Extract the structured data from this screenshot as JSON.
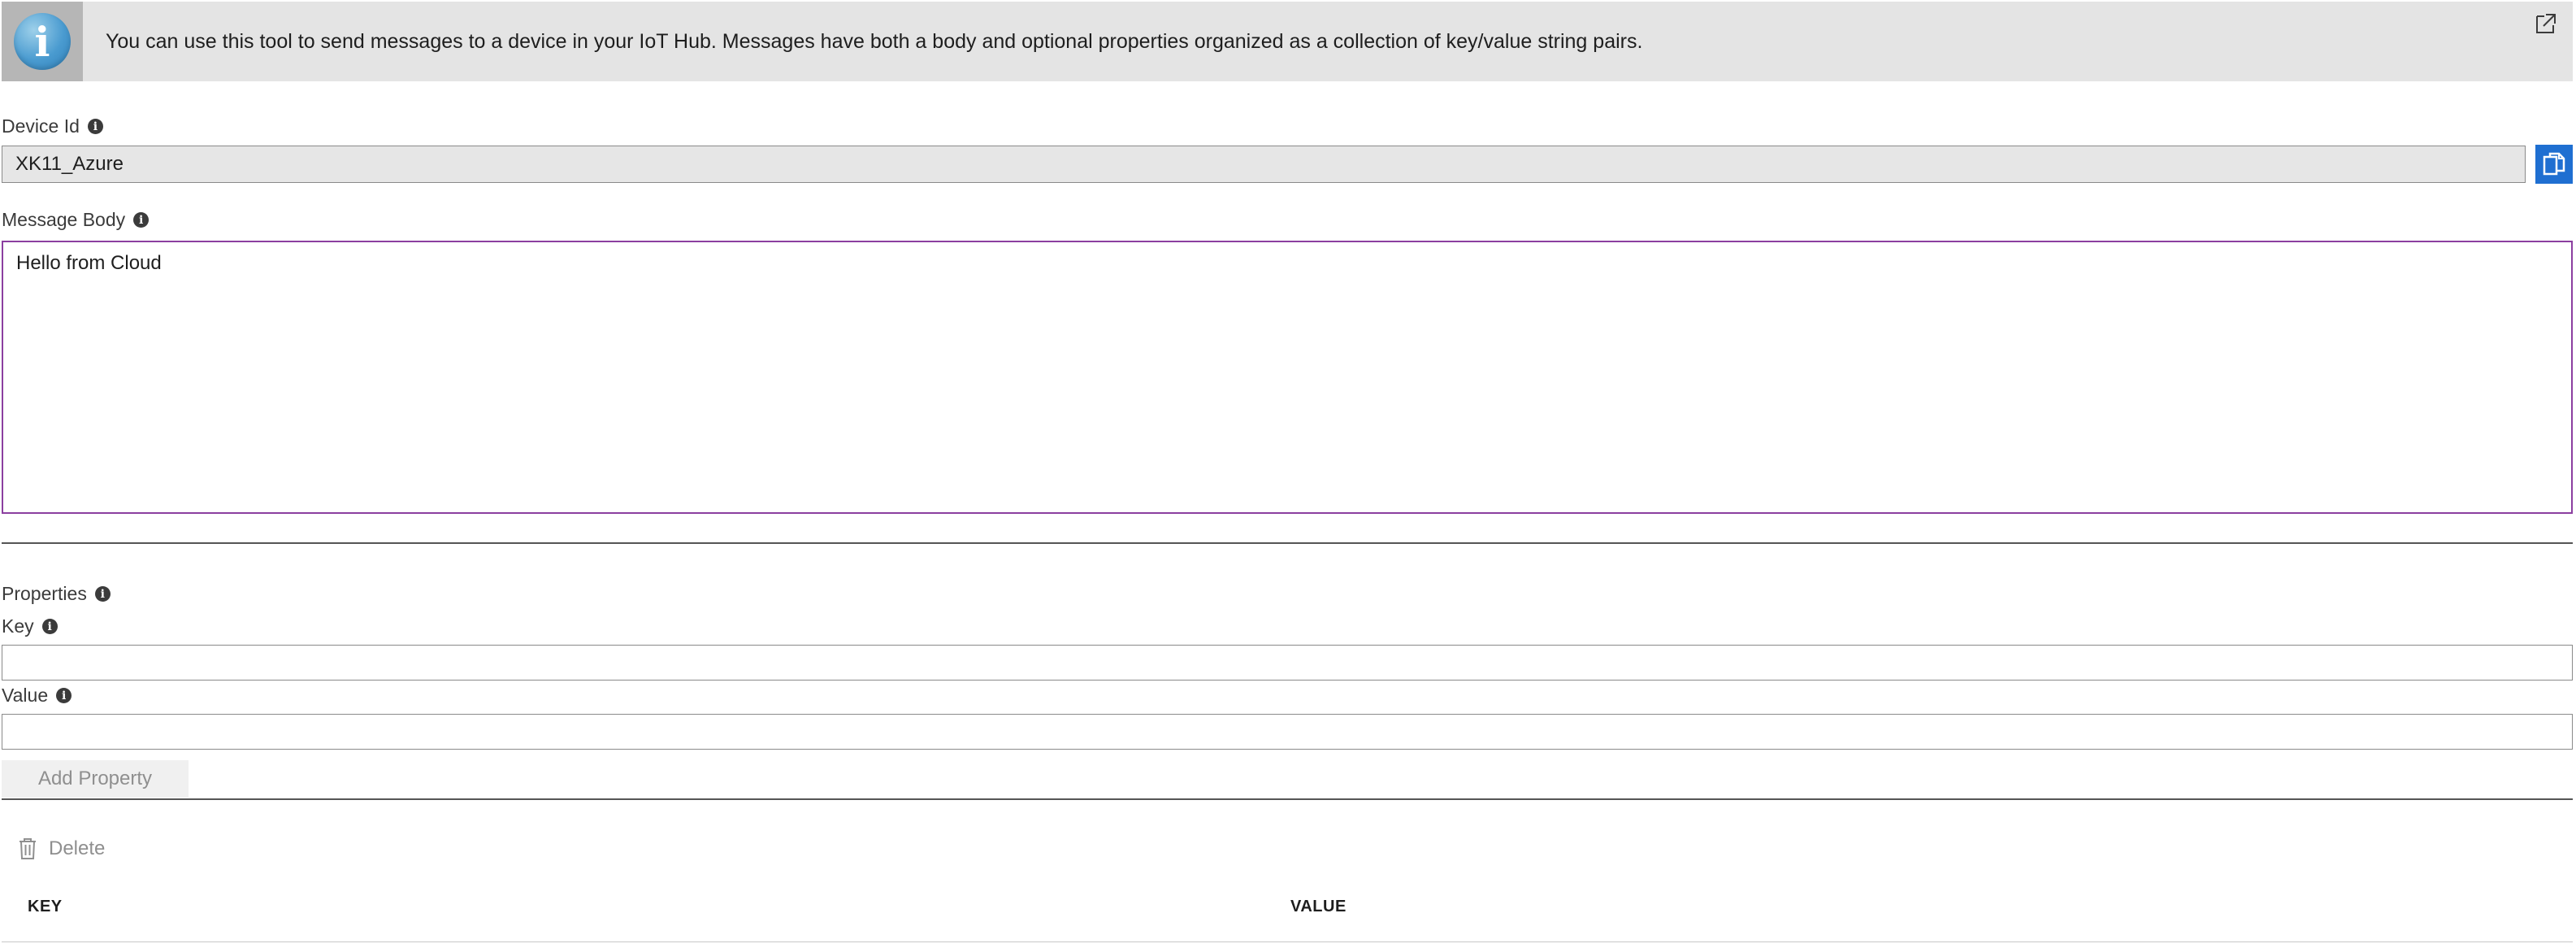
{
  "banner": {
    "text": "You can use this tool to send messages to a device in your IoT Hub. Messages have both a body and optional properties organized as a collection of key/value string pairs.",
    "info_glyph": "i",
    "icon": "info-icon",
    "popout_icon": "popout-icon"
  },
  "device": {
    "label": "Device Id",
    "value": "XK11_Azure",
    "copy_icon": "copy-icon"
  },
  "message": {
    "label": "Message Body",
    "value": "Hello from Cloud",
    "focus_color": "#8b3fa0"
  },
  "properties": {
    "label": "Properties",
    "key_label": "Key",
    "key_value": "",
    "value_label": "Value",
    "value_value": "",
    "add_button": "Add Property"
  },
  "table": {
    "delete_label": "Delete",
    "delete_icon": "trash-icon",
    "columns": [
      "KEY",
      "VALUE"
    ],
    "rows": []
  },
  "colors": {
    "accent": "#1f6fd1",
    "banner_bg": "#e4e4e4"
  }
}
